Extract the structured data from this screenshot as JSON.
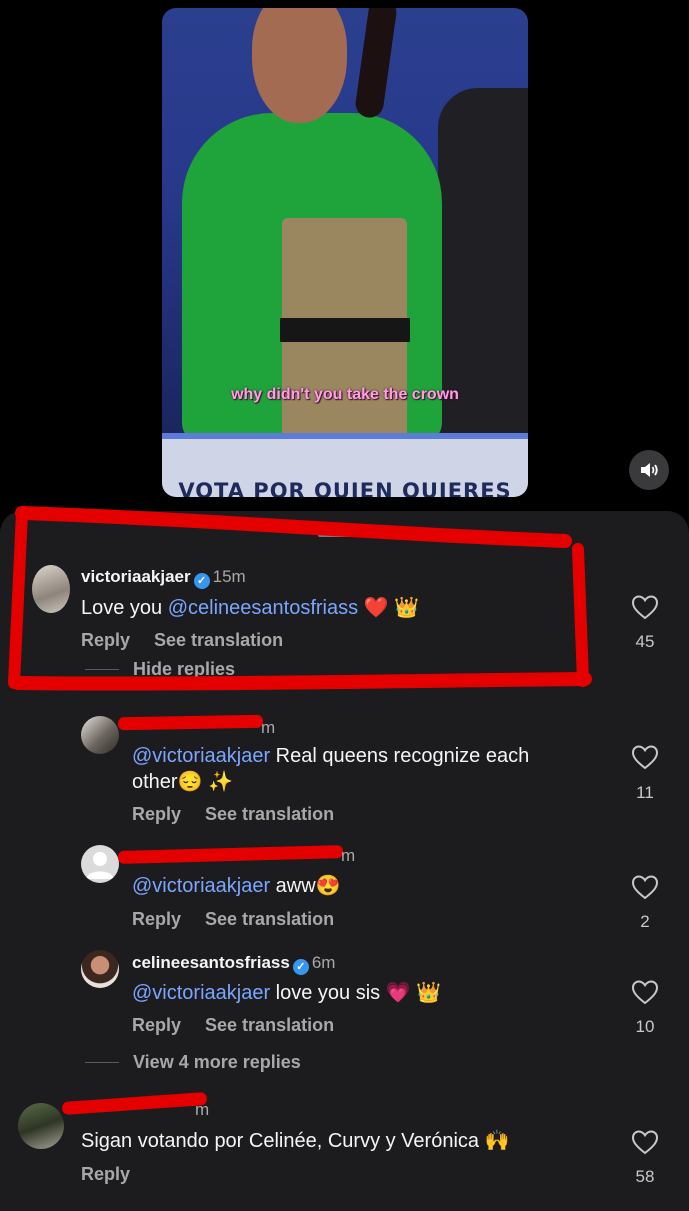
{
  "video": {
    "caption": "why didn't you take the crown",
    "banner_text": "VOTA POR QUIEN QUIERES"
  },
  "comments": [
    {
      "username": "victoriaakjaer",
      "verified": true,
      "time": "15m",
      "text_plain": "Love you ",
      "mention": "@celineesantosfriass",
      "emoji": "❤️ 👑",
      "reply": "Reply",
      "see_translation": "See translation",
      "likes": "45",
      "hide_replies": "Hide replies"
    },
    {
      "time_partial": "m",
      "mention": "@victoriaakjaer",
      "text_line1": " Real queens recognize each",
      "text_line2": "other",
      "emoji": "😔 ✨",
      "reply": "Reply",
      "see_translation": "See translation",
      "likes": "11"
    },
    {
      "time_partial": "m",
      "mention": "@victoriaakjaer",
      "text_plain": " aww",
      "emoji": "😍",
      "reply": "Reply",
      "see_translation": "See translation",
      "likes": "2"
    },
    {
      "username": "celineesantosfriass",
      "verified": true,
      "time": "6m",
      "mention": "@victoriaakjaer",
      "text_plain": " love you sis",
      "emoji": "💗 👑",
      "reply": "Reply",
      "see_translation": "See translation",
      "likes": "10",
      "view_more": "View 4 more replies"
    },
    {
      "time_partial": "m",
      "text_plain": "Sigan votando por Celinée,  Curvy y Verónica",
      "emoji": "🙌",
      "reply": "Reply",
      "likes": "58"
    }
  ],
  "colors": {
    "background": "#000000",
    "sheet": "#1c1c1e",
    "mention": "#7aa6ff",
    "verified": "#3797f0",
    "annotation_red": "#e50000"
  },
  "icons": [
    "speaker-icon",
    "heart-icon",
    "verified-badge-icon",
    "default-avatar-icon"
  ]
}
